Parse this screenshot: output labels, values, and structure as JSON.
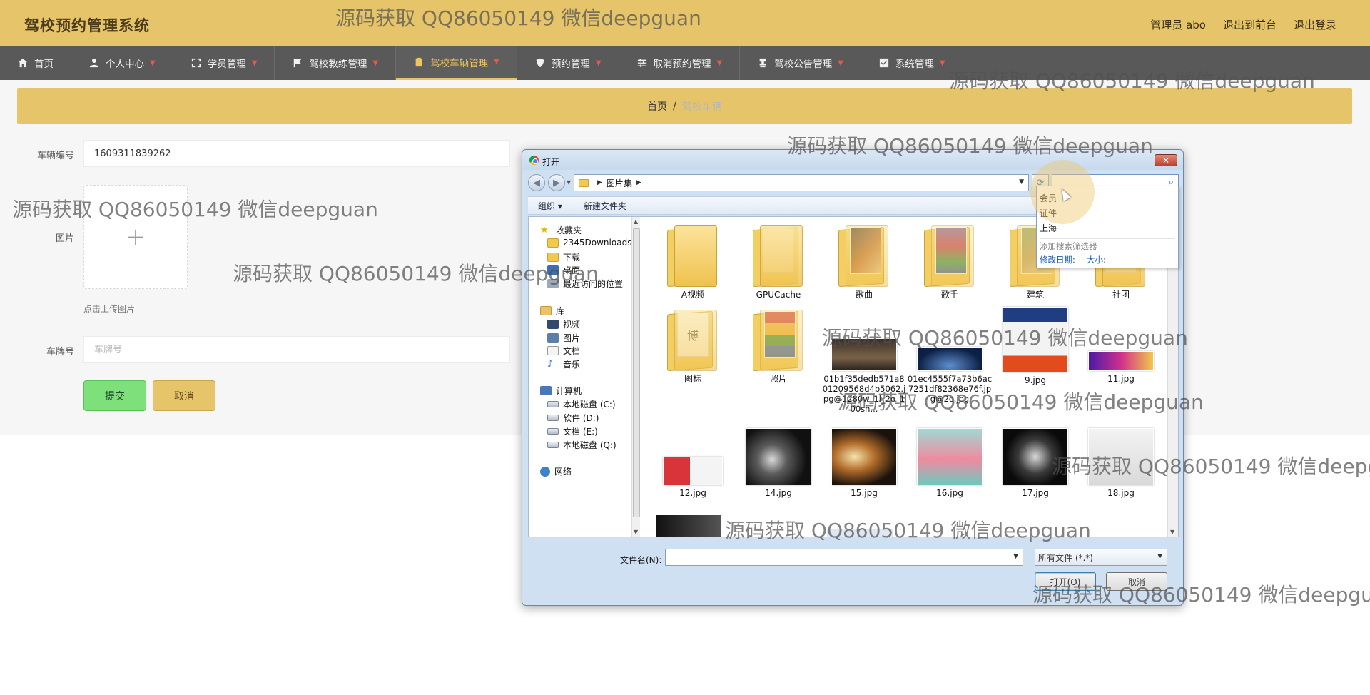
{
  "app": {
    "title": "驾校预约管理系统",
    "user_label": "管理员 abo",
    "back_to_front": "退出到前台",
    "logout": "退出登录"
  },
  "nav": [
    {
      "label": "首页",
      "icon": "home-icon",
      "active": false
    },
    {
      "label": "个人中心",
      "icon": "user-icon",
      "active": false
    },
    {
      "label": "学员管理",
      "icon": "expand-icon",
      "active": false
    },
    {
      "label": "驾校教练管理",
      "icon": "flag-icon",
      "active": false
    },
    {
      "label": "驾校车辆管理",
      "icon": "clipboard-icon",
      "active": true
    },
    {
      "label": "预约管理",
      "icon": "shield-icon",
      "active": false
    },
    {
      "label": "取消预约管理",
      "icon": "sliders-icon",
      "active": false
    },
    {
      "label": "驾校公告管理",
      "icon": "stamp-icon",
      "active": false
    },
    {
      "label": "系统管理",
      "icon": "check-icon",
      "active": false
    }
  ],
  "breadcrumb": {
    "home": "首页",
    "sep": "/",
    "current": "驾校车辆"
  },
  "form": {
    "vehicle_no_label": "车辆编号",
    "vehicle_no_value": "1609311839262",
    "image_label": "图片",
    "upload_hint": "点击上传图片",
    "plate_label": "车牌号",
    "plate_placeholder": "车牌号",
    "submit_label": "提交",
    "cancel_label": "取消"
  },
  "dialog": {
    "title": "打开",
    "close_label": "✕",
    "path": "图片集",
    "toolbar": {
      "organize": "组织 ▾",
      "new_folder": "新建文件夹"
    },
    "tree": {
      "favorites": "收藏夹",
      "fav_items": [
        "2345Downloads",
        "下载",
        "桌面",
        "最近访问的位置"
      ],
      "libraries": "库",
      "lib_items": [
        "视频",
        "图片",
        "文档",
        "音乐"
      ],
      "computer": "计算机",
      "drives": [
        "本地磁盘 (C:)",
        "软件 (D:)",
        "文档 (E:)",
        "本地磁盘 (Q:)"
      ],
      "network": "网络"
    },
    "files": [
      "A视频",
      "GPUCache",
      "歌曲",
      "歌手",
      "建筑",
      "社团",
      "图标",
      "照片",
      "01b1f35dedb571a801209568d4b5062.jpg@1280w_1l_2o_100sh...",
      "01ec4555f7a73b6ac7251df82368e76f.jpg@2o.jpg",
      "9.jpg",
      "11.jpg",
      "12.jpg",
      "14.jpg",
      "15.jpg",
      "16.jpg",
      "17.jpg",
      "18.jpg"
    ],
    "filename_label": "文件名(N):",
    "filetype": "所有文件 (*.*)",
    "open_label": "打开(O)",
    "cancel_label": "取消",
    "search_suggestions": [
      "会员",
      "证件",
      "上海"
    ],
    "search_hint": "添加搜索筛选器",
    "filter_date": "修改日期:",
    "filter_size": "大小:"
  },
  "watermark": "源码获取 QQ86050149 微信deepguan",
  "colors": {
    "header": "#e6c46a",
    "nav": "#595959",
    "accent": "#f0c55c",
    "submit": "#7ee07a"
  }
}
